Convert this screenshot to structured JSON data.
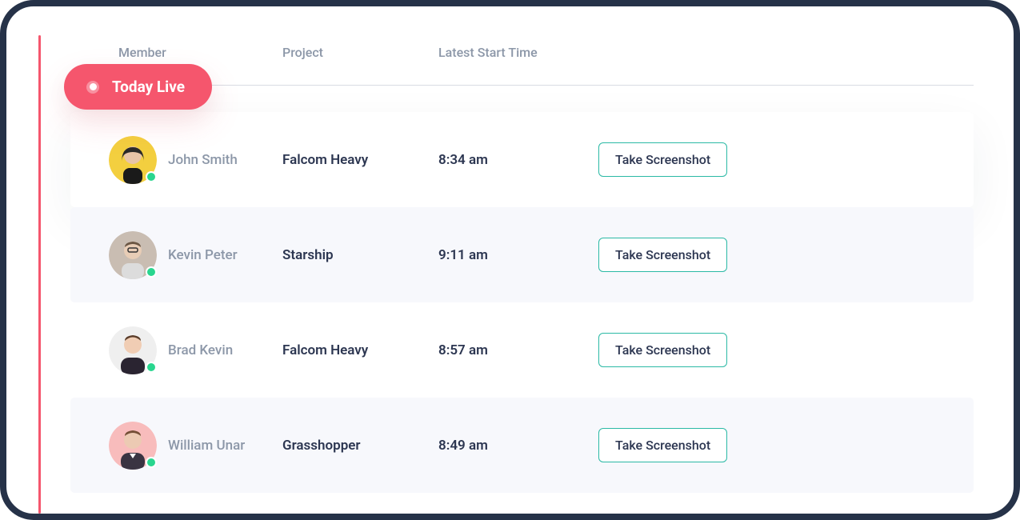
{
  "badge": {
    "label": "Today Live"
  },
  "headers": {
    "member": "Member",
    "project": "Project",
    "time": "Latest Start Time"
  },
  "action_label": "Take Screenshot",
  "colors": {
    "accent": "#f5566d",
    "button_border": "#2bb9a5",
    "status_online": "#29d68f"
  },
  "rows": [
    {
      "name": "John Smith",
      "project": "Falcom Heavy",
      "time": "8:34 am",
      "online": true
    },
    {
      "name": "Kevin Peter",
      "project": "Starship",
      "time": "9:11 am",
      "online": true
    },
    {
      "name": "Brad Kevin",
      "project": "Falcom Heavy",
      "time": "8:57 am",
      "online": true
    },
    {
      "name": "William Unar",
      "project": "Grasshopper",
      "time": "8:49 am",
      "online": true
    }
  ]
}
